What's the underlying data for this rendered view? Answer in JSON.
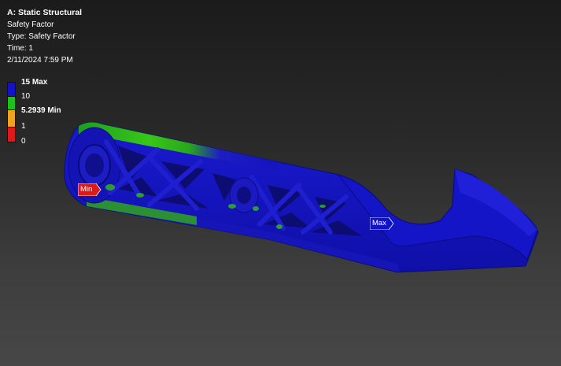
{
  "analysis": {
    "title": "A: Static Structural",
    "result": "Safety Factor",
    "type": "Type: Safety Factor",
    "time": "Time: 1",
    "datetime": "2/11/2024 7:59 PM"
  },
  "legend": {
    "items": [
      {
        "label": "15 Max",
        "color": "#1212c8"
      },
      {
        "label": "10",
        "color": "#19c319"
      },
      {
        "label": "5.2939 Min",
        "color": "#f0a41a"
      },
      {
        "label": "1",
        "color": "#f0a41a"
      },
      {
        "label": "0",
        "color": "#e01818"
      }
    ]
  },
  "markers": {
    "min": {
      "label": "Min",
      "color": "#e01818"
    },
    "max": {
      "label": "Max",
      "color": "#1212c8"
    }
  },
  "colors": {
    "body": "#1616c4",
    "highlight": "#2aa61c",
    "background_top": "#1b1b1b",
    "background_bottom": "#474747"
  }
}
